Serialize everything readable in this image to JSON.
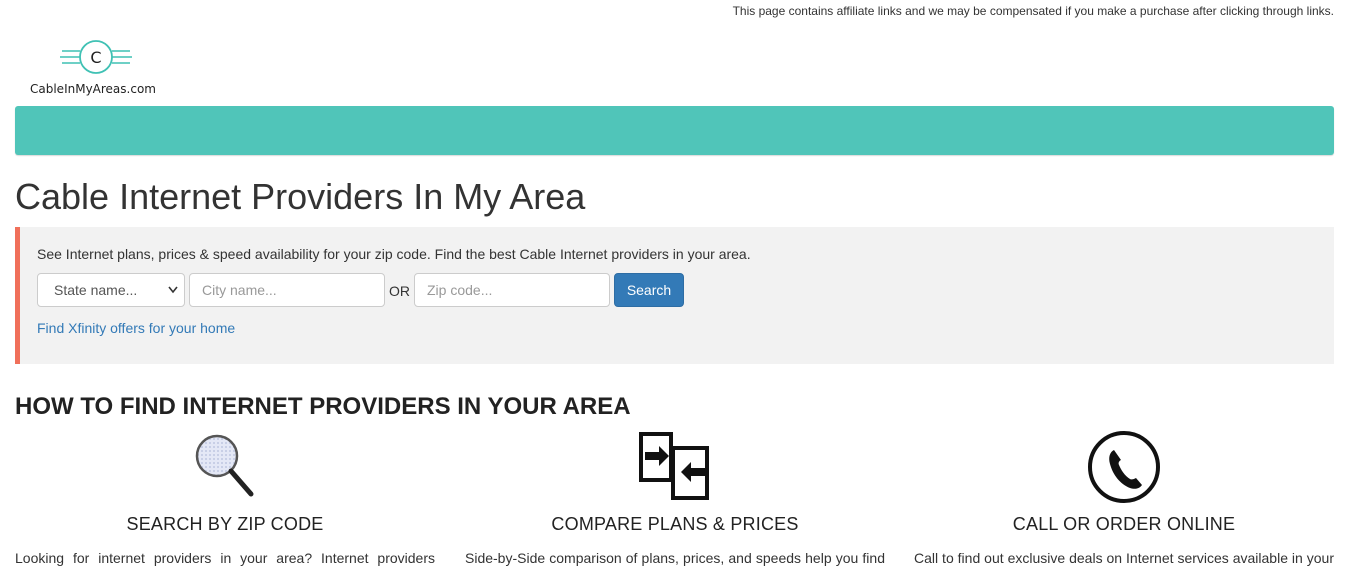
{
  "affiliate_notice": "This page contains affiliate links and we may be compensated if you make a purchase after clicking through links.",
  "logo": {
    "letter": "C",
    "text": "CableInMyAreas.com",
    "color": "#3fc1b4"
  },
  "navbar": {
    "color": "#50c5b9"
  },
  "page_title": "Cable Internet Providers In My Area",
  "search": {
    "intro": "See Internet plans, prices & speed availability for your zip code. Find the best Cable Internet providers in your area.",
    "state_select": "State name...",
    "city_placeholder": "City name...",
    "or_label": "OR",
    "zip_placeholder": "Zip code...",
    "button_label": "Search",
    "xfinity_link": "Find Xfinity offers for your home",
    "accent_color": "#f0705a"
  },
  "how_to": {
    "heading": "HOW TO FIND INTERNET PROVIDERS IN YOUR AREA",
    "features": [
      {
        "icon": "magnifying-glass-icon",
        "title": "SEARCH BY ZIP CODE",
        "desc": "Looking for internet providers in your area? Internet providers"
      },
      {
        "icon": "compare-documents-icon",
        "title": "COMPARE PLANS & PRICES",
        "desc": "Side-by-Side comparison of plans, prices, and speeds help you find"
      },
      {
        "icon": "phone-icon",
        "title": "CALL OR ORDER ONLINE",
        "desc": "Call to find out exclusive deals on Internet services available in your"
      }
    ]
  }
}
